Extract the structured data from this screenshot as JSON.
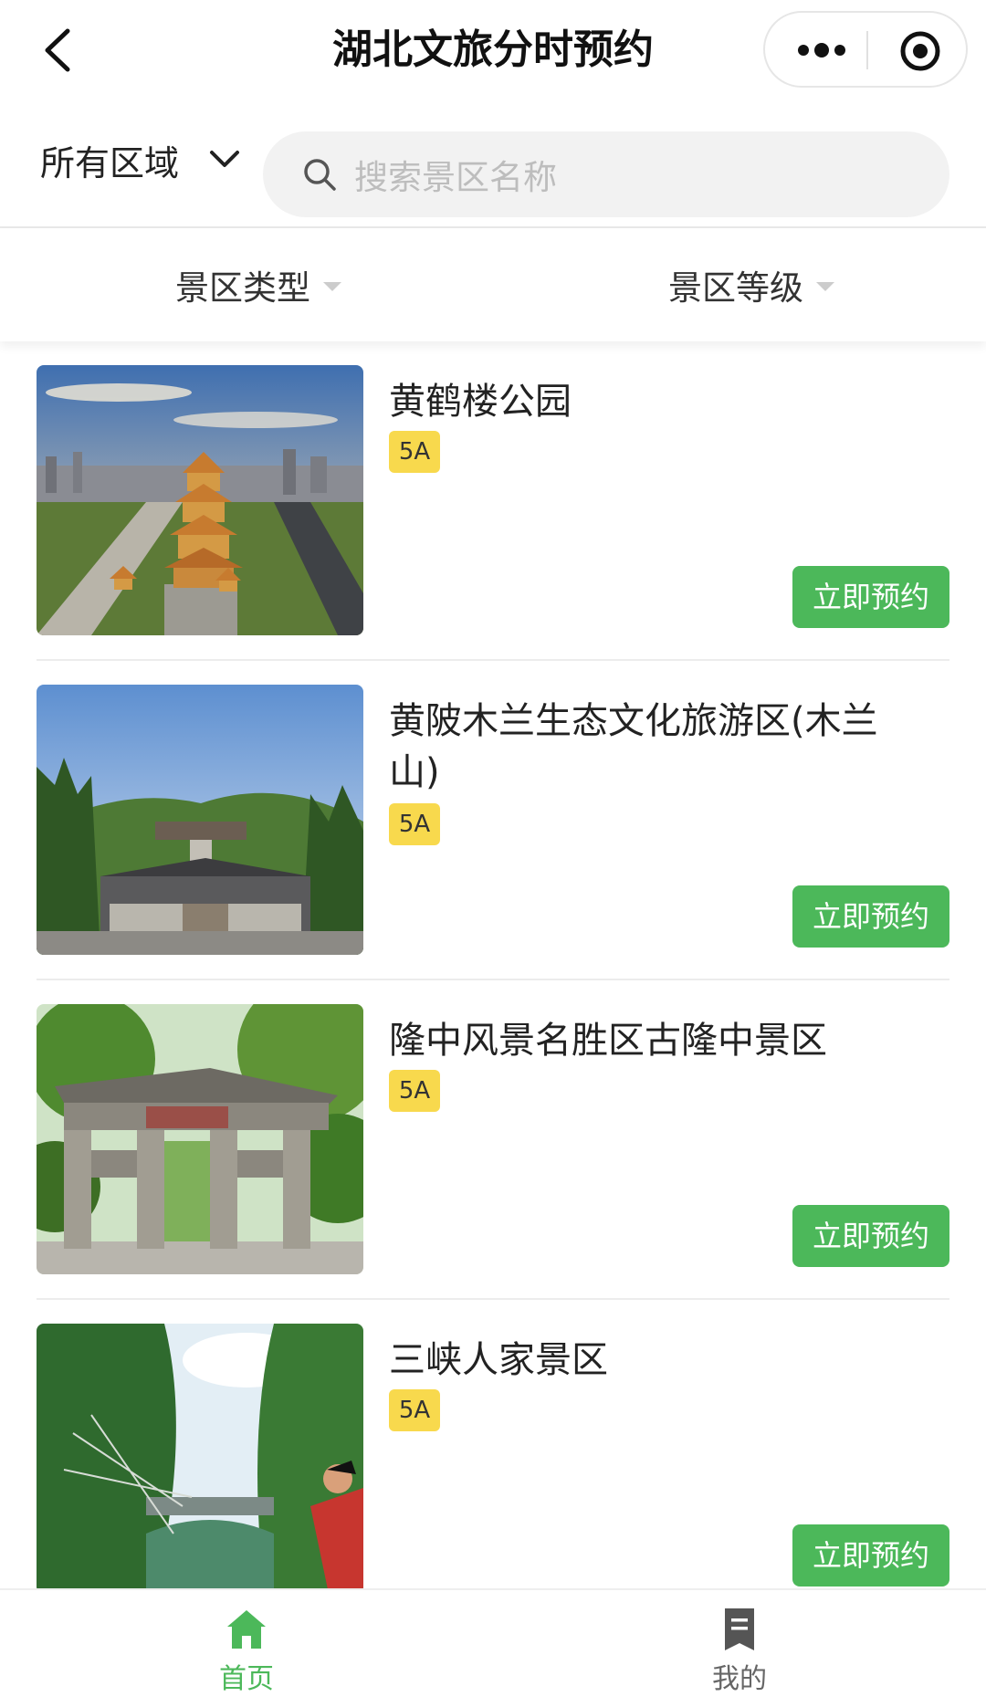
{
  "header": {
    "title": "湖北文旅分时预约"
  },
  "search": {
    "region": "所有区域",
    "placeholder": "搜索景区名称"
  },
  "filters": {
    "type_label": "景区类型",
    "level_label": "景区等级"
  },
  "spots": [
    {
      "name": "黄鹤楼公园",
      "grade": "5A",
      "button": "立即预约"
    },
    {
      "name": "黄陂木兰生态文化旅游区(木兰山)",
      "grade": "5A",
      "button": "立即预约"
    },
    {
      "name": "隆中风景名胜区古隆中景区",
      "grade": "5A",
      "button": "立即预约"
    },
    {
      "name": "三峡人家景区",
      "grade": "5A",
      "button": "立即预约"
    }
  ],
  "tabbar": {
    "home": "首页",
    "mine": "我的"
  },
  "colors": {
    "accent": "#4cb85a",
    "badge": "#f8d94d"
  }
}
